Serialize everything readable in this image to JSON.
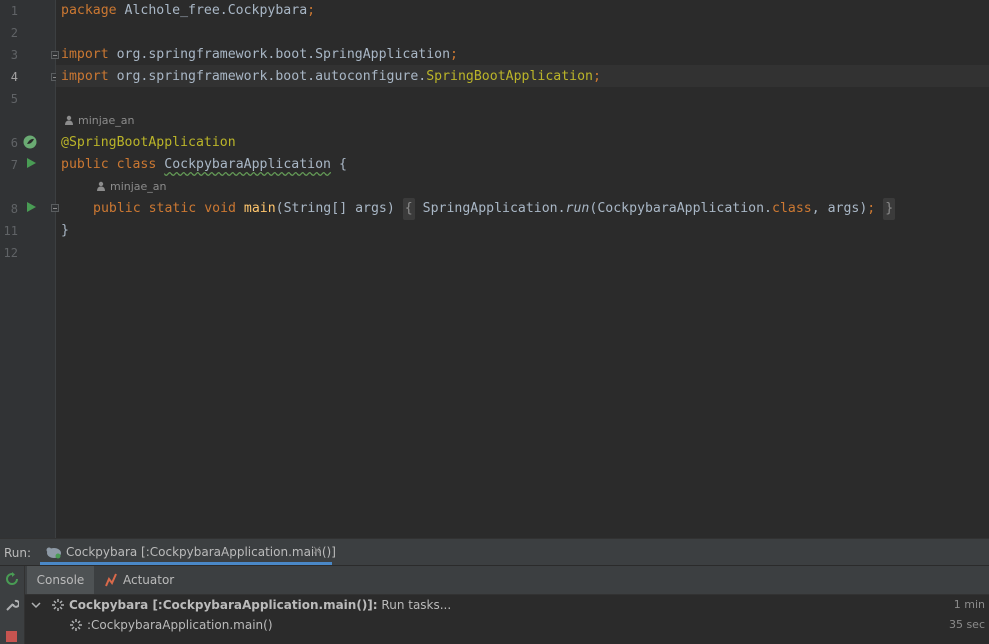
{
  "editor": {
    "line_numbers": [
      "1",
      "2",
      "3",
      "4",
      "5",
      "6",
      "7",
      "8",
      "11",
      "12"
    ],
    "lines": {
      "l1_kw": "package",
      "l1_rest": " Alchole_free.Cockpybara",
      "l1_semi": ";",
      "l3_kw": "import",
      "l3_rest": " org.springframework.boot.SpringApplication",
      "l3_semi": ";",
      "l4_kw": "import",
      "l4_rest": " org.springframework.boot.autoconfigure.",
      "l4_cls": "SpringBootApplication",
      "l4_semi": ";",
      "l6_ann": "@SpringBootApplication",
      "l7_kw1": "public",
      "l7_kw2": "class",
      "l7_cls": "CockpybaraApplication",
      "l7_brace": "{",
      "l8_kw1": "public",
      "l8_kw2": "static",
      "l8_kw3": "void",
      "l8_fn": "main",
      "l8_params": "(String[] args)",
      "l8_open": "{",
      "l8_call1": "SpringApplication.",
      "l8_run": "run",
      "l8_args1": "(CockpybaraApplication.",
      "l8_classkw": "class",
      "l8_args2": ", args)",
      "l8_semi": ";",
      "l8_close": "}",
      "l11_brace": "}"
    },
    "author_hint_1": "minjae_an",
    "author_hint_2": "minjae_an"
  },
  "run_panel": {
    "label": "Run:",
    "tab_title": "Cockpybara [:CockpybaraApplication.main()]",
    "tab_close": "×",
    "subtabs": [
      "Console",
      "Actuator"
    ],
    "tree": [
      {
        "title_bold": "Cockpybara [:CockpybaraApplication.main()]:",
        "title_rest": " Run tasks...",
        "time": "1 min"
      },
      {
        "title": ":CockpybaraApplication.main()",
        "time": "35 sec"
      }
    ]
  },
  "colors": {
    "background": "#2b2b2b",
    "keyword": "#cc7832",
    "annotation": "#bbb529",
    "function": "#ffc66d",
    "text": "#a9b7c6",
    "run_green": "#499c54"
  }
}
